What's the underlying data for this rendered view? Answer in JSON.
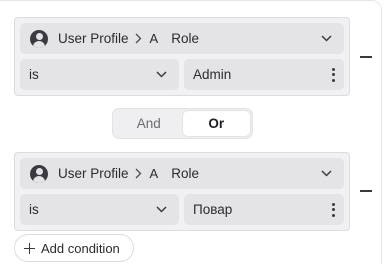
{
  "conditions": [
    {
      "path": [
        "User Profile",
        "Role"
      ],
      "operator": "is",
      "value": "Admin"
    },
    {
      "path": [
        "User Profile",
        "Role"
      ],
      "operator": "is",
      "value": "Повар"
    }
  ],
  "combinator": {
    "options": [
      "And",
      "Or"
    ],
    "selected": "Or"
  },
  "add_condition_label": "Add condition",
  "icons": {
    "entity": "user-circle-icon",
    "attribute": "text-type-icon",
    "path_separator": "chevron-right-icon",
    "dropdown": "chevron-down-icon",
    "more": "kebab-menu-icon",
    "remove": "minus-icon",
    "add": "plus-icon"
  },
  "attribute_type_glyph": "A"
}
